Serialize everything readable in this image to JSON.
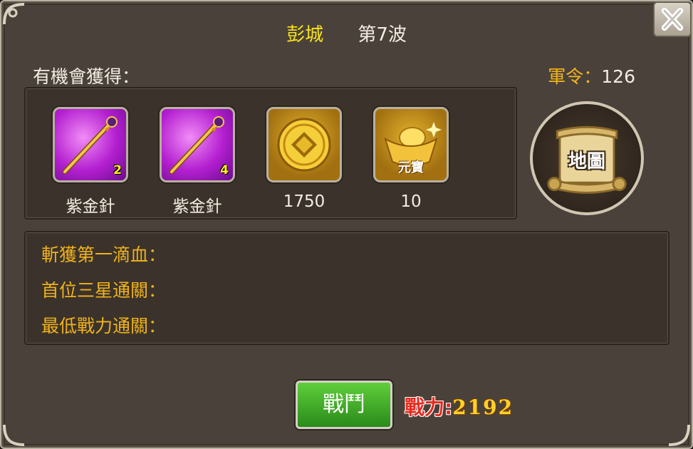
{
  "header": {
    "city": "彭城",
    "wave": "第7波"
  },
  "rewards": {
    "label": "有機會獲得：",
    "items": [
      {
        "name": "紫金針",
        "qty": "2",
        "icon": "purple-needle-icon"
      },
      {
        "name": "紫金針",
        "qty": "4",
        "icon": "purple-needle-icon"
      },
      {
        "name": "1750",
        "qty": "",
        "icon": "coin-icon"
      },
      {
        "name": "10",
        "qty": "",
        "icon": "gold-ingot-icon",
        "icon_text": "元寶"
      }
    ]
  },
  "orders": {
    "label": "軍令：",
    "value": "126"
  },
  "map_button": {
    "label": "地圖"
  },
  "records": [
    {
      "label": "斬獲第一滴血："
    },
    {
      "label": "首位三星通關："
    },
    {
      "label": "最低戰力通關："
    }
  ],
  "fight_button": {
    "label": "戰鬥"
  },
  "power": {
    "label": "戰力:",
    "value": "2192"
  },
  "colors": {
    "accent_gold": "#f4b41e",
    "city_yellow": "#f7e41a",
    "button_green": "#3fae2a",
    "power_red": "#e82a1f"
  }
}
